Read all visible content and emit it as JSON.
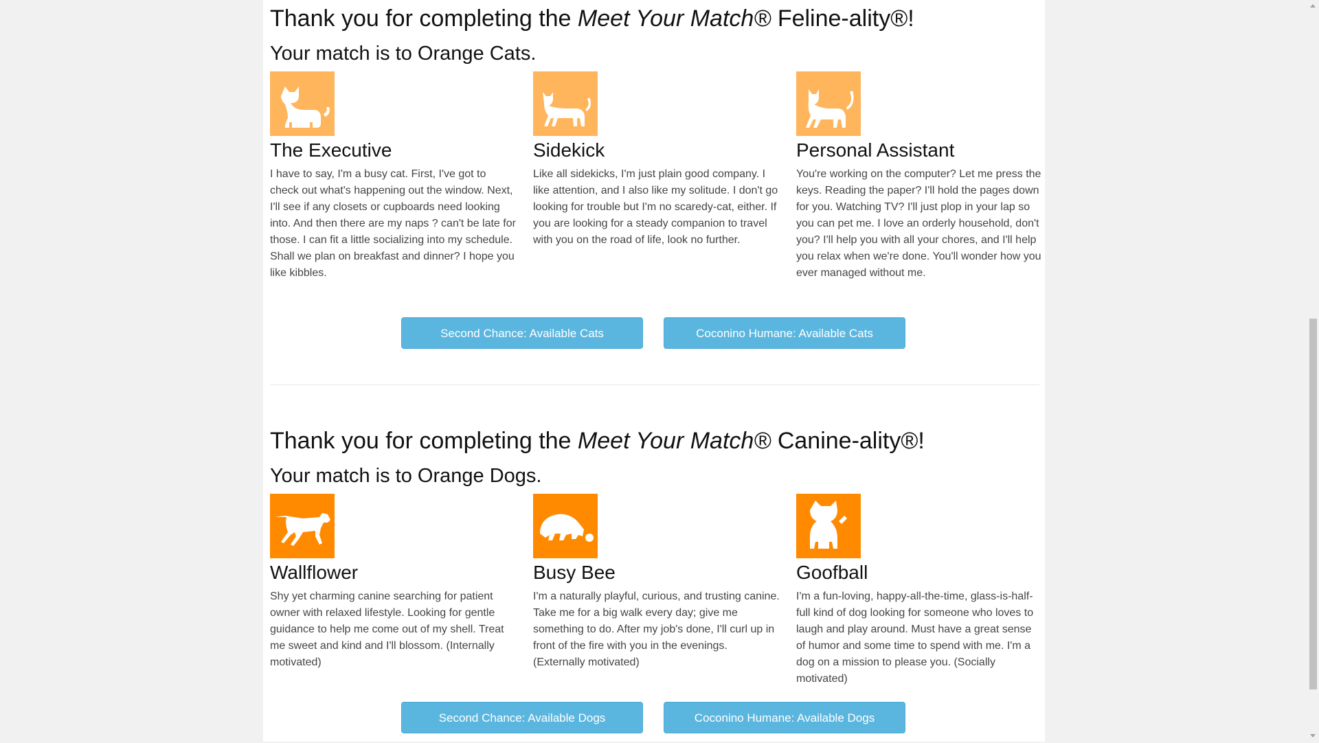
{
  "feline": {
    "title_prefix": "Thank you for completing the ",
    "title_brand": "Meet Your Match®",
    "title_suffix": " Feline-ality®!",
    "match_text": "Your match is to Orange Cats.",
    "tile_color": "#ffb55c",
    "cards": [
      {
        "name": "The Executive",
        "icon": "cat-sitting-icon",
        "description": "I have to say, I'm a busy cat. First, I've got to check out what's happening out the window. Next, I'll see if any closets or cupboards need looking into. And then there are my naps ? can't be late for those. I can fit a little socializing into my schedule. Shall we plan on breakfast and dinner? I hope you like kibbles."
      },
      {
        "name": "Sidekick",
        "icon": "cat-walking-icon",
        "description": "Like all sidekicks, I'm just plain good company. I like attention, and I also like my solitude. I don't go looking for trouble but I'm no scaredy-cat, either. If you are looking for a steady companion to travel with you on the road of life, look no further."
      },
      {
        "name": "Personal Assistant",
        "icon": "cat-strutting-icon",
        "description": "You're working on the computer? Let me press the keys. Reading the paper? I'll hold the pages down for you. Watching TV? I'll just plop in your lap so you can pet me. I love an orderly household, don't you? I'll help you with all your chores, and I'll help you relax when we're done. You'll wonder how you ever managed without me."
      }
    ],
    "buttons": [
      {
        "label": "Second Chance: Available Cats"
      },
      {
        "label": "Coconino Humane: Available Cats"
      }
    ]
  },
  "canine": {
    "title_prefix": "Thank you for completing the ",
    "title_brand": "Meet Your Match®",
    "title_suffix": " Canine-ality®!",
    "match_text": "Your match is to Orange Dogs.",
    "tile_color": "#ff8a00",
    "cards": [
      {
        "name": "Wallflower",
        "icon": "dog-standing-icon",
        "description": "Shy yet charming canine searching for patient owner with relaxed lifestyle. Looking for gentle guidance to help me come out of my shell. Treat me sweet and kind and I'll blossom. (Internally motivated)"
      },
      {
        "name": "Busy Bee",
        "icon": "dog-with-ball-icon",
        "description": "I'm a naturally playful, curious, and trusting canine. Take me for a big walk every day; give me something to do. After my job's done, I'll curl up in front of the fire with you in the evenings. (Externally motivated)"
      },
      {
        "name": "Goofball",
        "icon": "dog-sitting-icon",
        "description": "I'm a fun-loving, happy-all-the-time, glass-is-half-full kind of dog looking for someone who loves to laugh and play around. Must have a great sense of humor and some time to spend with me. I'm a dog on a mission to please you. (Socially motivated)"
      }
    ],
    "buttons": [
      {
        "label": "Second Chance: Available Dogs"
      },
      {
        "label": "Coconino Humane: Available Dogs"
      }
    ]
  },
  "colors": {
    "button": "#5bb6df",
    "page_bg": "#f1f1f1"
  }
}
